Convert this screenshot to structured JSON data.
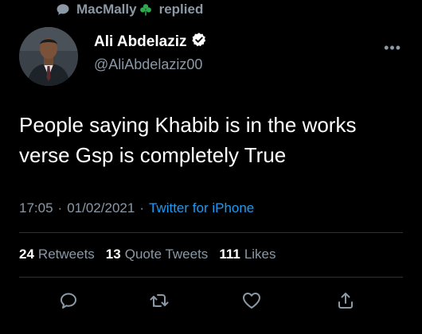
{
  "reply_context": {
    "user": "MacMally",
    "label": "replied",
    "icon": "comment-bubble-icon",
    "badge_icon": "shamrock-icon"
  },
  "author": {
    "name": "Ali Abdelaziz",
    "handle": "@AliAbdelaziz00",
    "verified_icon": "verified-badge-icon"
  },
  "tweet": {
    "text_line1": "People saying Khabib is in the works",
    "text_line2": "verse Gsp is completely True"
  },
  "meta": {
    "time": "17:05",
    "separator": "·",
    "date": "01/02/2021",
    "separator2": "·",
    "source": "Twitter for iPhone"
  },
  "stats": {
    "retweets_count": "24",
    "retweets_label": "Retweets",
    "quotes_count": "13",
    "quotes_label": "Quote Tweets",
    "likes_count": "111",
    "likes_label": "Likes"
  },
  "more_label": "•••",
  "colors": {
    "background": "#000000",
    "secondary_text": "#8b98a5",
    "link": "#1d9bf0",
    "divider": "#2f3336",
    "verified": "#ffffff",
    "shamrock": "#2fa84f"
  }
}
